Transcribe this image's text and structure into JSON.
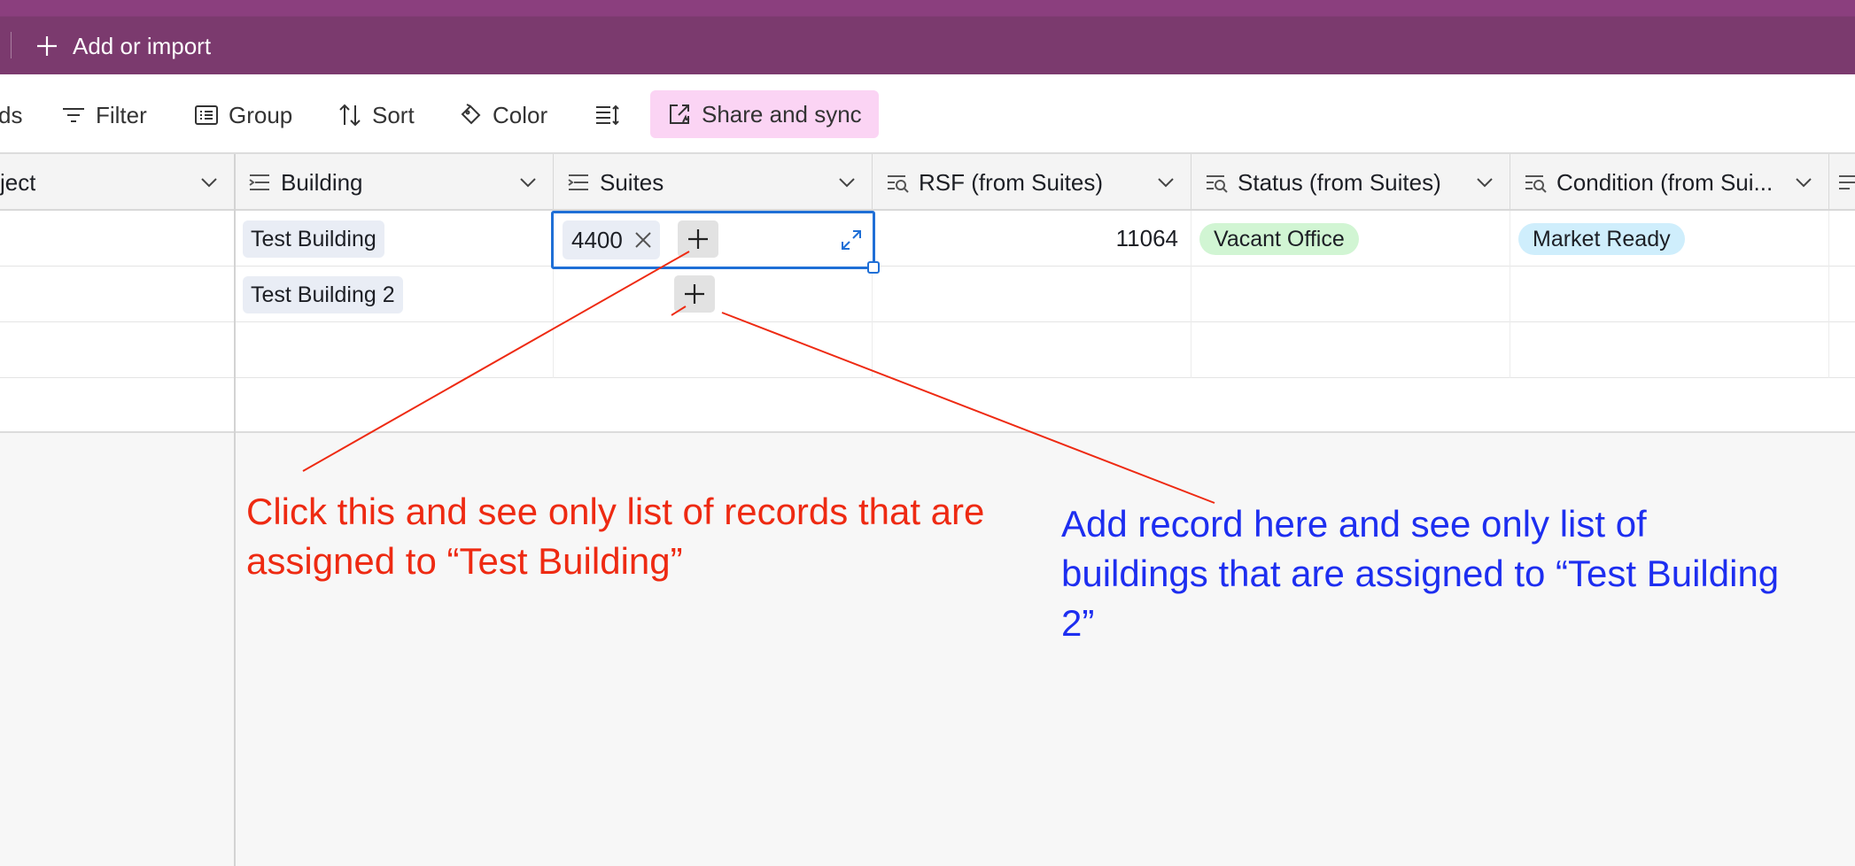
{
  "topbar": {
    "add_import_label": "Add or import"
  },
  "toolbar": {
    "fields_partial": "ds",
    "filter": "Filter",
    "group": "Group",
    "sort": "Sort",
    "color": "Color",
    "share_sync": "Share and sync",
    "share_bg": "#fbd4f4"
  },
  "columns": [
    {
      "label": "ject",
      "icon": "none"
    },
    {
      "label": "Building",
      "icon": "link-icon"
    },
    {
      "label": "Suites",
      "icon": "link-icon"
    },
    {
      "label": "RSF (from Suites)",
      "icon": "lookup-icon"
    },
    {
      "label": "Status (from Suites)",
      "icon": "lookup-icon"
    },
    {
      "label": "Condition (from Sui...",
      "icon": "lookup-icon"
    }
  ],
  "rows": [
    {
      "building": "Test Building",
      "suites": "4400",
      "rsf": "11064",
      "status": "Vacant Office",
      "condition": "Market Ready"
    },
    {
      "building": "Test Building 2",
      "suites": "",
      "rsf": "",
      "status": "",
      "condition": ""
    }
  ],
  "annotations": {
    "red": "Click this and see only list of records that are assigned to “Test Building”",
    "blue": "Add record here and see only list of buildings that are assigned to “Test Building 2”",
    "red_color": "#ee2a12",
    "blue_color": "#1d2ef0"
  }
}
